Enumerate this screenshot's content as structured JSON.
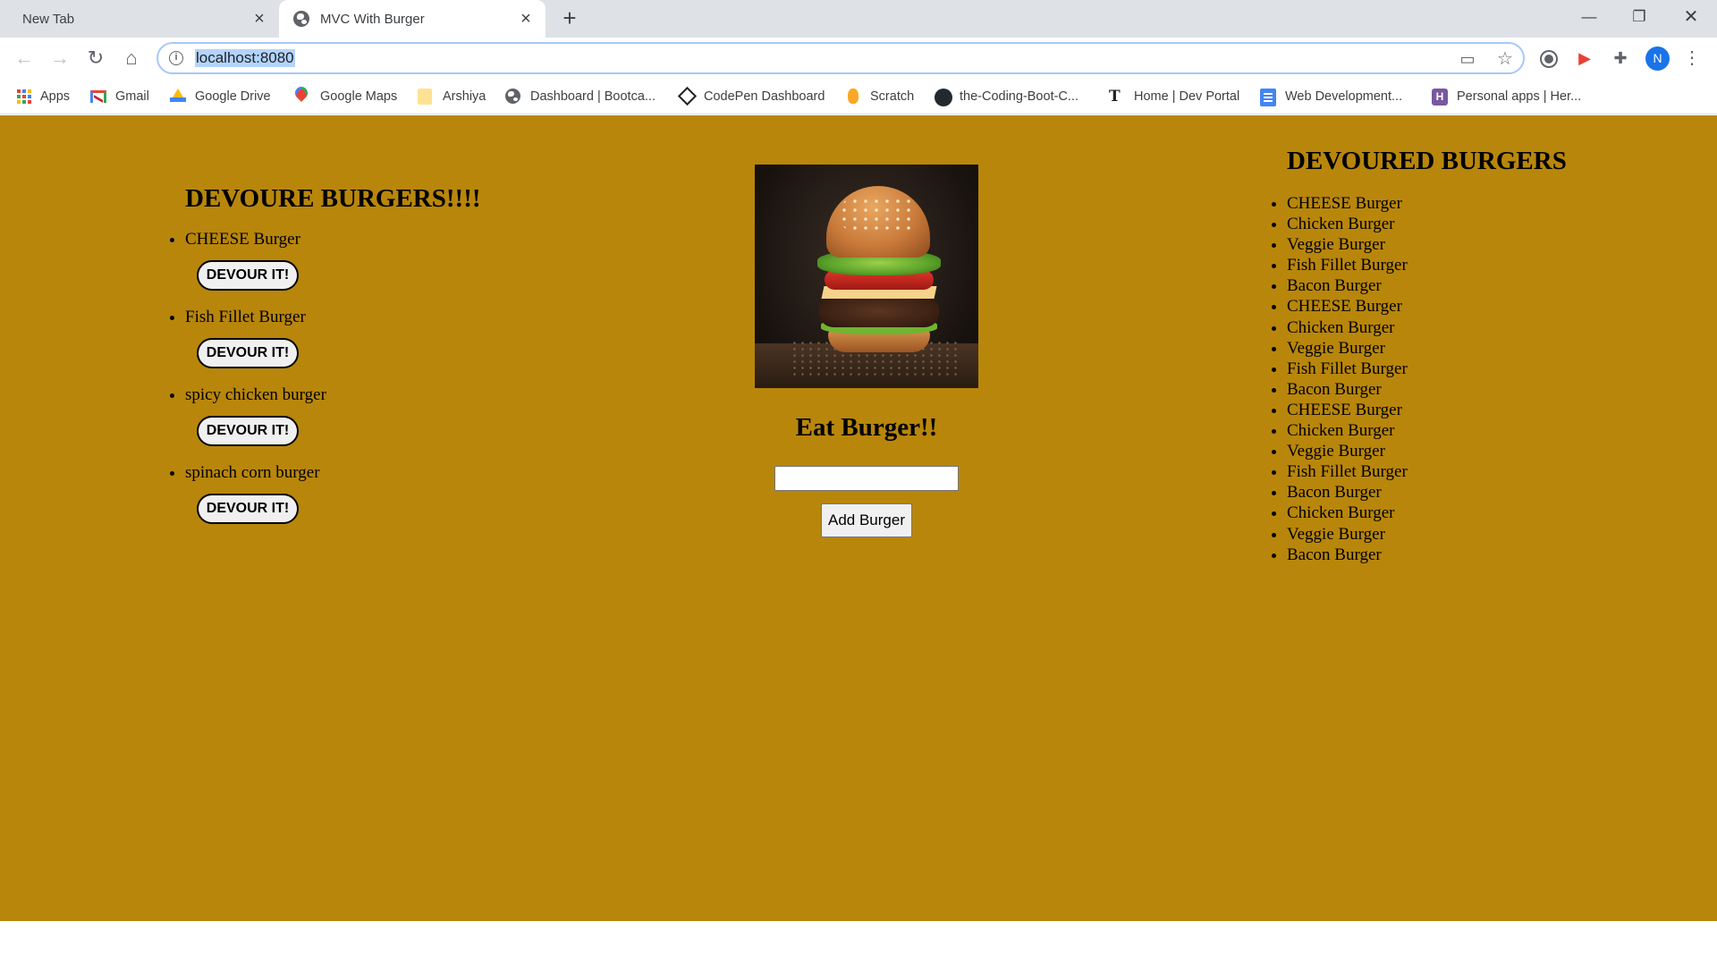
{
  "browser": {
    "tabs": [
      {
        "label": "New Tab",
        "active": false
      },
      {
        "label": "MVC With Burger",
        "active": true
      }
    ],
    "address": "localhost:8080",
    "profile_initial": "N",
    "bookmarks": [
      {
        "label": "Apps",
        "icon": "apps-grid-icon"
      },
      {
        "label": "Gmail",
        "icon": "gmail-icon"
      },
      {
        "label": "Google Drive",
        "icon": "google-drive-icon"
      },
      {
        "label": "Google Maps",
        "icon": "google-maps-icon"
      },
      {
        "label": "Arshiya",
        "icon": "folder-icon"
      },
      {
        "label": "Dashboard | Bootca...",
        "icon": "globe-icon"
      },
      {
        "label": "CodePen Dashboard",
        "icon": "codepen-icon"
      },
      {
        "label": "Scratch",
        "icon": "scratch-icon"
      },
      {
        "label": "the-Coding-Boot-C...",
        "icon": "github-icon"
      },
      {
        "label": "Home | Dev Portal",
        "icon": "nyt-icon"
      },
      {
        "label": "Web Development...",
        "icon": "google-docs-icon"
      },
      {
        "label": "Personal apps | Her...",
        "icon": "heroku-icon"
      }
    ]
  },
  "page": {
    "background_color": "#b8860b",
    "left": {
      "title": "DEVOURE BURGERS!!!!",
      "button_label": "DEVOUR IT!",
      "burgers": [
        "CHEESE Burger",
        "Fish Fillet Burger",
        "spicy chicken burger",
        "spinach corn burger"
      ]
    },
    "center": {
      "image_alt": "burger photo",
      "title": "Eat Burger!!",
      "input_value": "",
      "add_button_label": "Add Burger"
    },
    "right": {
      "title": "DEVOURED BURGERS",
      "burgers": [
        "CHEESE Burger",
        "Chicken Burger",
        "Veggie Burger",
        "Fish Fillet Burger",
        "Bacon Burger",
        "CHEESE Burger",
        "Chicken Burger",
        "Veggie Burger",
        "Fish Fillet Burger",
        "Bacon Burger",
        "CHEESE Burger",
        "Chicken Burger",
        "Veggie Burger",
        "Fish Fillet Burger",
        "Bacon Burger",
        "Chicken Burger",
        "Veggie Burger",
        "Bacon Burger"
      ]
    }
  }
}
